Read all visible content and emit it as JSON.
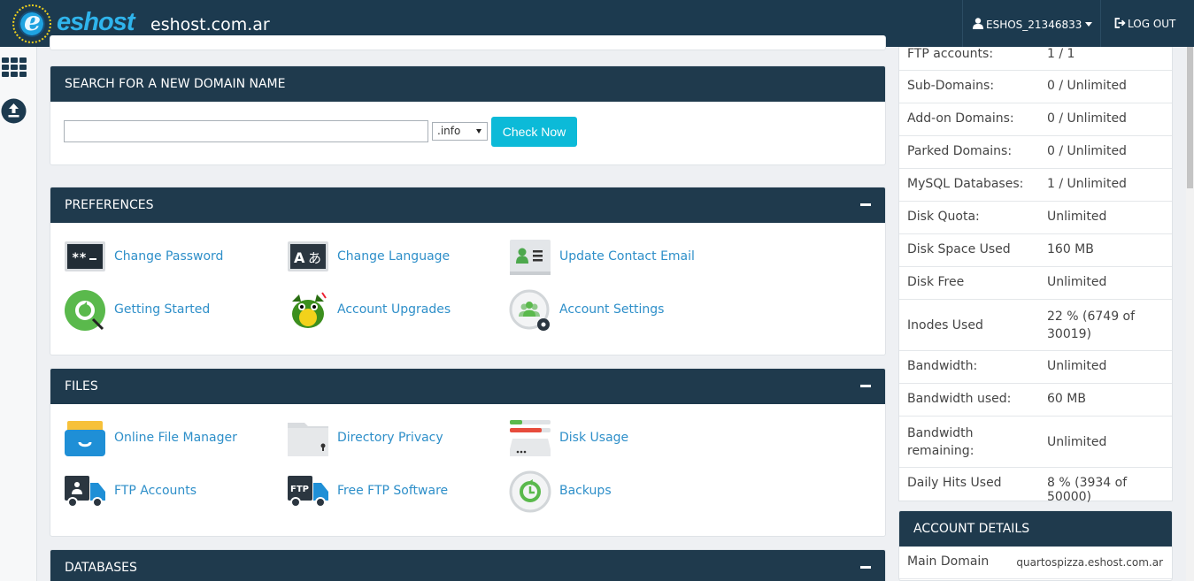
{
  "header": {
    "logo_text": "eshost",
    "site_name": "eshost.com.ar",
    "username": "ESHOS_21346833",
    "logout_label": "LOG OUT"
  },
  "search": {
    "title": "SEARCH FOR A NEW DOMAIN NAME",
    "input_value": "",
    "tld": ".info",
    "button": "Check Now"
  },
  "preferences": {
    "title": "PREFERENCES",
    "items": [
      {
        "label": "Change Password",
        "icon": "password-icon"
      },
      {
        "label": "Change Language",
        "icon": "language-icon"
      },
      {
        "label": "Update Contact Email",
        "icon": "contact-card-icon"
      },
      {
        "label": "Getting Started",
        "icon": "getting-started-icon"
      },
      {
        "label": "Account Upgrades",
        "icon": "dragon-icon"
      },
      {
        "label": "Account Settings",
        "icon": "account-settings-icon"
      }
    ]
  },
  "files": {
    "title": "FILES",
    "items": [
      {
        "label": "Online File Manager",
        "icon": "file-manager-icon"
      },
      {
        "label": "Directory Privacy",
        "icon": "folder-lock-icon"
      },
      {
        "label": "Disk Usage",
        "icon": "disk-usage-icon"
      },
      {
        "label": "FTP Accounts",
        "icon": "ftp-accounts-truck-icon"
      },
      {
        "label": "Free FTP Software",
        "icon": "ftp-software-truck-icon"
      },
      {
        "label": "Backups",
        "icon": "backups-icon"
      }
    ]
  },
  "databases": {
    "title": "DATABASES"
  },
  "stats": [
    {
      "k": "FTP accounts:",
      "v": "1 / 1"
    },
    {
      "k": "Sub-Domains:",
      "v": "0 / Unlimited"
    },
    {
      "k": "Add-on Domains:",
      "v": "0 / Unlimited"
    },
    {
      "k": "Parked Domains:",
      "v": "0 / Unlimited"
    },
    {
      "k": "MySQL Databases:",
      "v": "1 / Unlimited"
    },
    {
      "k": "Disk Quota:",
      "v": "Unlimited"
    },
    {
      "k": "Disk Space Used",
      "v": "160 MB"
    },
    {
      "k": "Disk Free",
      "v": "Unlimited"
    },
    {
      "k": "Inodes Used",
      "v": "22 % (6749 of 30019)"
    },
    {
      "k": "Bandwidth:",
      "v": "Unlimited"
    },
    {
      "k": "Bandwidth used:",
      "v": "60 MB"
    },
    {
      "k": "Bandwidth remaining:",
      "v": "Unlimited"
    },
    {
      "k": "Daily Hits Used",
      "v": "8 % (3934 of 50000)"
    }
  ],
  "account_details": {
    "title": "ACCOUNT DETAILS",
    "main_domain_label": "Main Domain",
    "main_domain_value": "quartospizza.eshost.com.ar"
  }
}
